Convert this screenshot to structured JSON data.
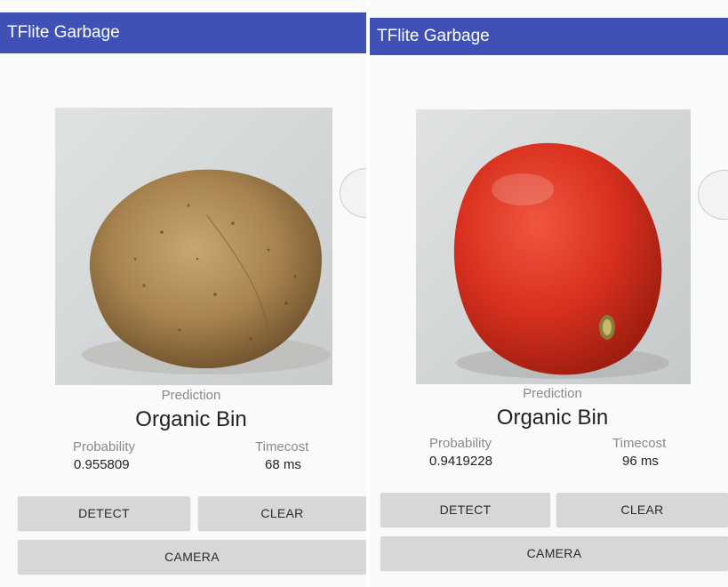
{
  "colors": {
    "app_bar": "#3f51b5",
    "background": "#fafafa",
    "button": "#d6d7d7",
    "muted_text": "#8a8a8a"
  },
  "screens": [
    {
      "app_title": "TFlite Garbage",
      "image_subject": "potato",
      "prediction_label": "Prediction",
      "prediction_value": "Organic Bin",
      "probability_label": "Probability",
      "probability_value": "0.955809",
      "timecost_label": "Timecost",
      "timecost_value": "68 ms",
      "buttons": {
        "detect": "DETECT",
        "clear": "CLEAR",
        "camera": "CAMERA"
      }
    },
    {
      "app_title": "TFlite Garbage",
      "image_subject": "tomato",
      "prediction_label": "Prediction",
      "prediction_value": "Organic Bin",
      "probability_label": "Probability",
      "probability_value": "0.9419228",
      "timecost_label": "Timecost",
      "timecost_value": "96 ms",
      "buttons": {
        "detect": "DETECT",
        "clear": "CLEAR",
        "camera": "CAMERA"
      }
    }
  ]
}
